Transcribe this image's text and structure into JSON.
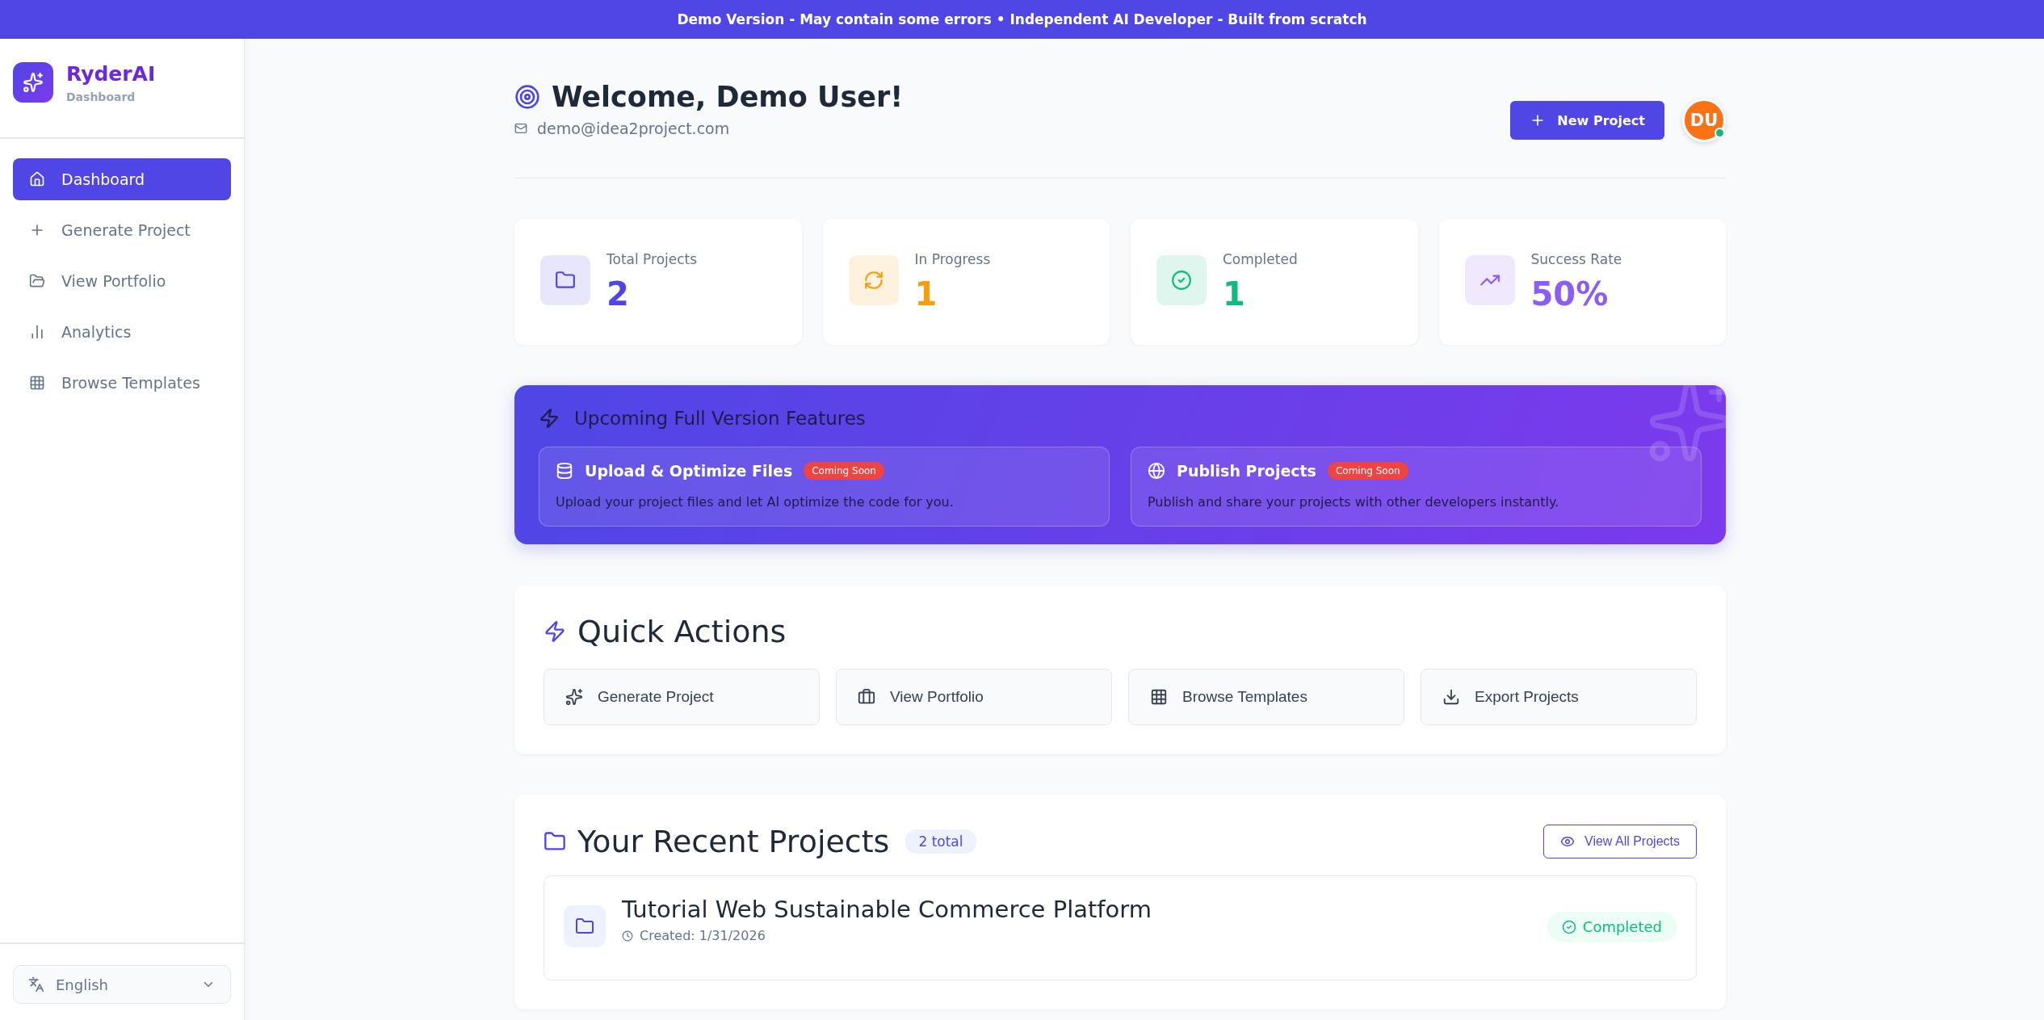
{
  "banner": {
    "text": "Demo Version - May contain some errors • Independent AI Developer - Built from scratch"
  },
  "sidebar": {
    "brand": "RyderAI",
    "subtitle": "Dashboard",
    "items": [
      {
        "label": "Dashboard",
        "selected": true
      },
      {
        "label": "Generate Project",
        "selected": false
      },
      {
        "label": "View Portfolio",
        "selected": false
      },
      {
        "label": "Analytics",
        "selected": false
      },
      {
        "label": "Browse Templates",
        "selected": false
      }
    ],
    "language": "English"
  },
  "header": {
    "title": "Welcome, Demo User!",
    "email": "demo@idea2project.com",
    "new_project": "New Project",
    "avatar": "DU",
    "online": true
  },
  "stats": [
    {
      "label": "Total Projects",
      "value": "2",
      "color": "#4f46e5"
    },
    {
      "label": "In Progress",
      "value": "1",
      "color": "#f59e0b"
    },
    {
      "label": "Completed",
      "value": "1",
      "color": "#10b981"
    },
    {
      "label": "Success Rate",
      "value": "50%",
      "color": "#8b5cf6"
    }
  ],
  "upcoming": {
    "title": "Upcoming Full Version Features",
    "features": [
      {
        "title": "Upload & Optimize Files",
        "badge": "Coming Soon",
        "description": "Upload your project files and let AI optimize the code for you."
      },
      {
        "title": "Publish Projects",
        "badge": "Coming Soon",
        "description": "Publish and share your projects with other developers instantly."
      }
    ]
  },
  "quick_actions": {
    "title": "Quick Actions",
    "actions": [
      "Generate Project",
      "View Portfolio",
      "Browse Templates",
      "Export Projects"
    ]
  },
  "recent": {
    "title": "Your Recent Projects",
    "count": "2 total",
    "view_all": "View All Projects",
    "projects": [
      {
        "name": "Tutorial Web Sustainable Commerce Platform",
        "created": "Created: 1/31/2026",
        "status": "Completed"
      }
    ]
  }
}
